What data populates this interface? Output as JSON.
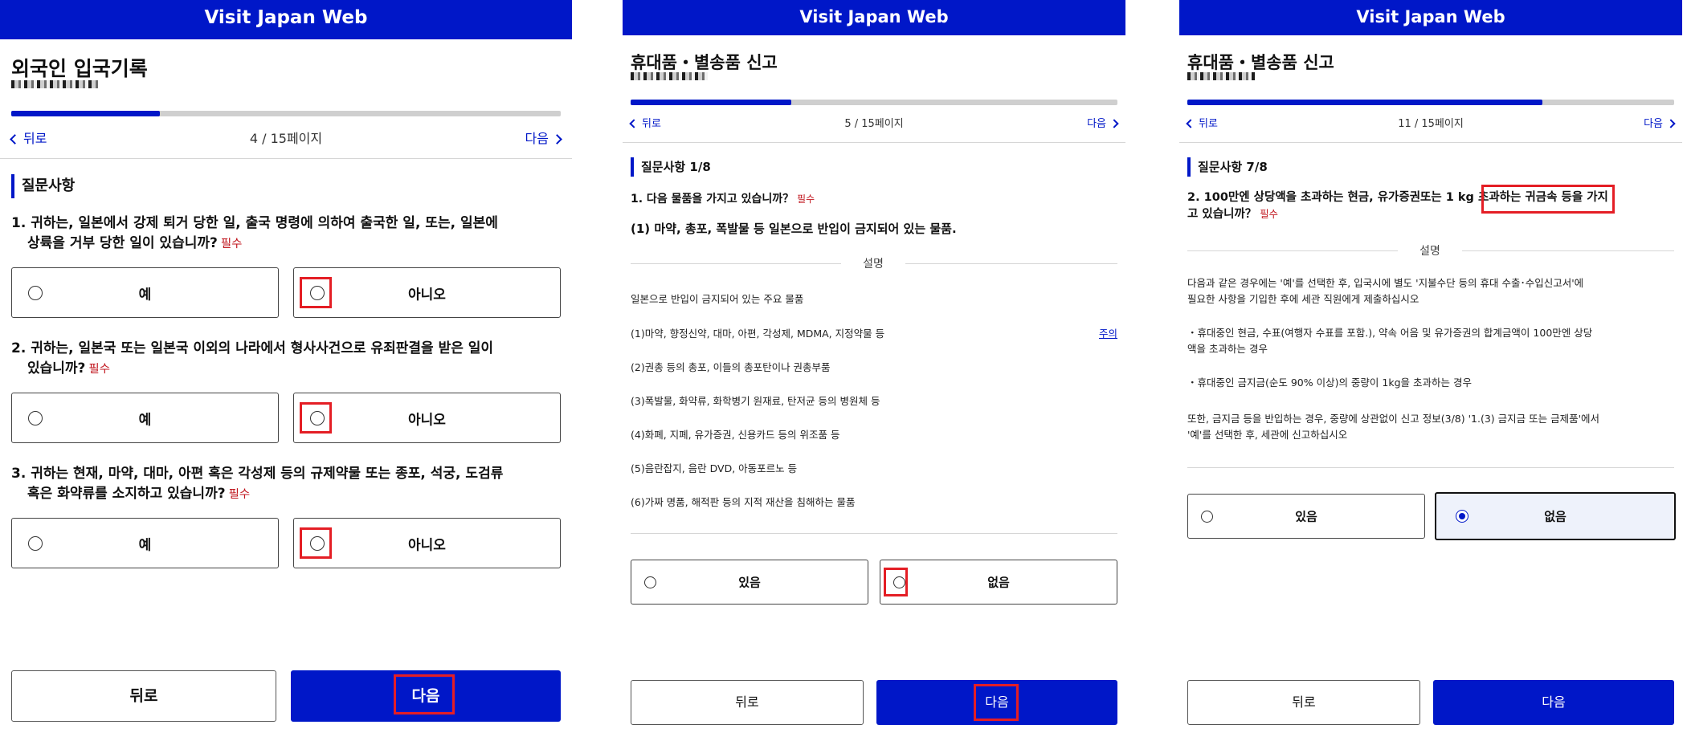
{
  "app_title": "Visit Japan Web",
  "colors": {
    "brand": "#0017c8",
    "required": "#c0141c",
    "highlight": "#e41e25"
  },
  "panel1": {
    "title": "외국인 입국기록",
    "progress": 0.27,
    "nav": {
      "back": "뒤로",
      "page": "4 / 15페이지",
      "next": "다음"
    },
    "section_title": "질문사항",
    "required": "필수",
    "questions": [
      {
        "line1": "1. 귀하는, 일본에서 강제 퇴거 당한 일, 출국 명령에 의하여 출국한 일, 또는, 일본에",
        "line2": "상륙을 거부 당한 일이 있습니까?",
        "yes": "예",
        "no": "아니오"
      },
      {
        "line1": "2. 귀하는, 일본국 또는 일본국 이외의 나라에서 형사사건으로 유죄판결을 받은 일이",
        "line2": "있습니까?",
        "yes": "예",
        "no": "아니오"
      },
      {
        "line1": "3. 귀하는 현재, 마약, 대마, 아편 혹은 각성제 등의 규제약물 또는 종포, 석궁, 도검류",
        "line2": "혹은 화약류를 소지하고 있습니까?",
        "yes": "예",
        "no": "아니오"
      }
    ],
    "buttons": {
      "back": "뒤로",
      "next": "다음"
    }
  },
  "panel2": {
    "title": "휴대품・별송품 신고",
    "progress": 0.33,
    "nav": {
      "back": "뒤로",
      "page": "5 / 15페이지",
      "next": "다음"
    },
    "section_title": "질문사항 1/8",
    "question": "1. 다음 물품을 가지고 있습니까？",
    "required": "필수",
    "subquestion": "(1) 마약, 총포, 폭발물 등 일본으로 반입이 금지되어 있는 물품.",
    "explanation_title": "설명",
    "intro": "일본으로 반입이 금지되어 있는 주요 물품",
    "items": [
      "(1)마약, 향정신약, 대마, 아편, 각성제, MDMA, 지정약물 등",
      "(2)권총 등의 총포, 이들의 총포탄이나 권총부품",
      "(3)폭발물, 화약류, 화학병기 원재료, 탄저균 등의 병원체 등",
      "(4)화폐, 지폐, 유가증권, 신용카드 등의 위조품 등",
      "(5)음란잡지, 음란 DVD, 아동포르노 등",
      "(6)가짜 명품, 해적판 등의 지적 재산을 침해하는 물품"
    ],
    "link": "주의",
    "options": {
      "yes": "있음",
      "no": "없음"
    },
    "buttons": {
      "back": "뒤로",
      "next": "다음"
    }
  },
  "panel3": {
    "title": "휴대품・별송품 신고",
    "progress": 0.73,
    "nav": {
      "back": "뒤로",
      "page": "11 / 15페이지",
      "next": "다음"
    },
    "section_title": "질문사항 7/8",
    "question_a": "2. 100만엔 상당액을 초과하는 현금, 유가증권또는 ",
    "question_hl": "1 kg 초과하는 귀금속",
    "question_b": "등을 가지",
    "question_line2": "고 있습니까？",
    "required": "필수",
    "explanation_title": "설명",
    "para1_line1": "다음과 같은 경우에는 '예'를 선택한 후, 입국시에 별도 '지불수단 등의 휴대 수출･수입신고서'에",
    "para1_line2": "필요한 사항을 기입한 후에 세관 직원에게 제출하십시오",
    "bullet1_line1": "・휴대중인 현금, 수표(여행자 수표를 포함.), 약속 어음 및 유가증권의 합계금액이 100만엔 상당",
    "bullet1_line2": "액을 초과하는 경우",
    "bullet2": "・휴대중인 금지금(순도 90% 이상)의 중량이 1kg을 초과하는 경우",
    "para2_line1": "또한, 금지금 등을 반입하는 경우, 중량에 상관없이 신고 정보(3/8) '1.(3) 금지금 또는 금제품'에서",
    "para2_line2": "'예'를 선택한 후, 세관에 신고하십시오",
    "options": {
      "yes": "있음",
      "no": "없음"
    },
    "buttons": {
      "back": "뒤로",
      "next": "다음"
    }
  }
}
